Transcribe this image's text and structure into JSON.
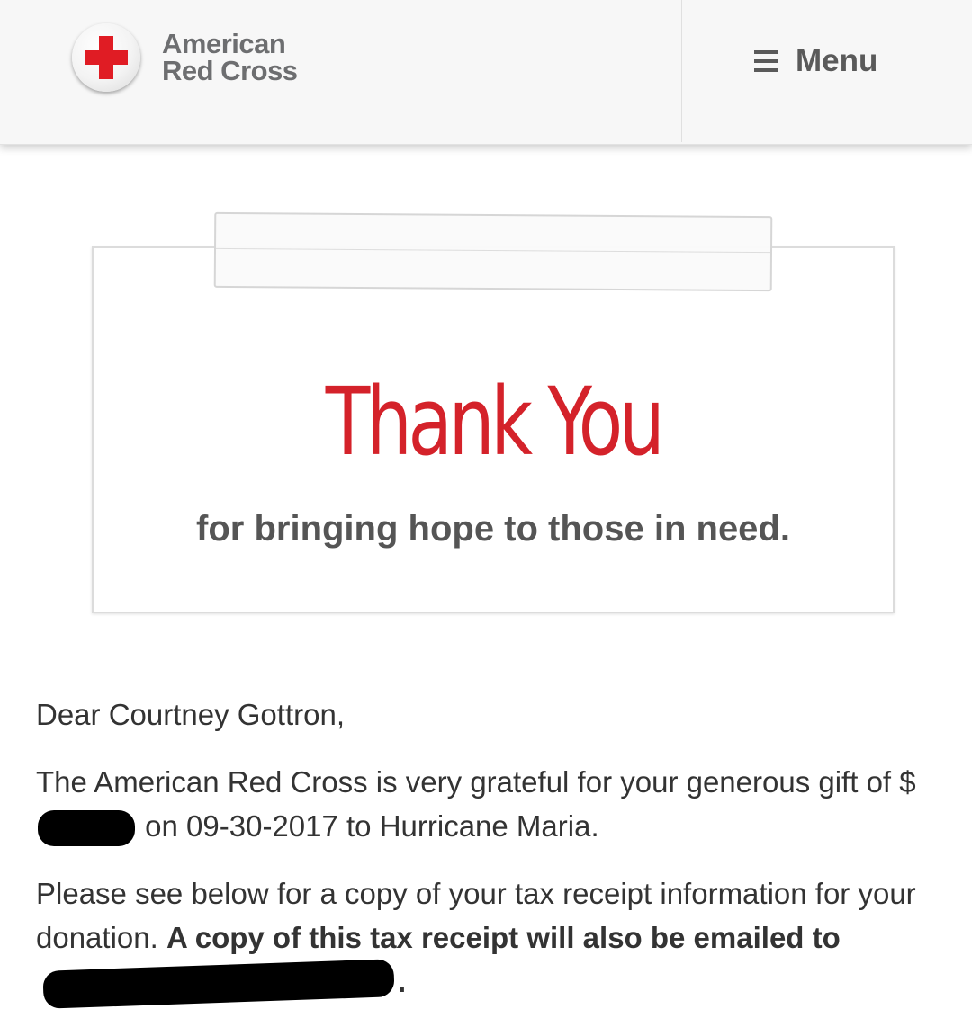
{
  "header": {
    "logo_line1": "American",
    "logo_line2": "Red Cross",
    "menu_label": "Menu",
    "brand_color": "#e01c24",
    "logo_icon": "red-cross-icon",
    "menu_icon": "hamburger-icon"
  },
  "card": {
    "title": "Thank You",
    "tagline": "for bringing hope to those in need.",
    "title_color": "#d4222a"
  },
  "letter": {
    "greeting": "Dear Courtney Gottron,",
    "p1_part1": "The American Red Cross is very grateful for your generous gift of $",
    "p1_part2": " on 09-30-2017 to Hurricane Maria.",
    "p2_part1": "Please see below for a copy of your tax receipt information for your donation. ",
    "p2_bold1": "A copy of this tax receipt will also be emailed to ",
    "p2_bold2": "."
  }
}
